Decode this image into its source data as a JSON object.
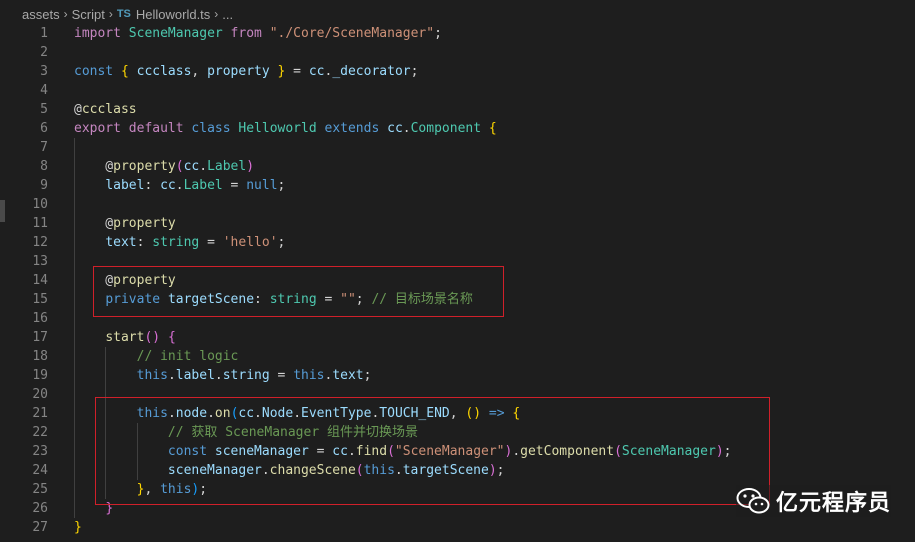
{
  "breadcrumb": {
    "items": [
      "assets",
      "Script",
      "Helloworld.ts",
      "..."
    ],
    "ts_badge": "TS"
  },
  "line_numbers": [
    "1",
    "2",
    "3",
    "4",
    "5",
    "6",
    "7",
    "8",
    "9",
    "10",
    "11",
    "12",
    "13",
    "14",
    "15",
    "16",
    "17",
    "18",
    "19",
    "20",
    "21",
    "22",
    "23",
    "24",
    "25",
    "26",
    "27"
  ],
  "code_lines": [
    [
      [
        "c",
        "import"
      ],
      [
        "p",
        " "
      ],
      [
        "t",
        "SceneManager"
      ],
      [
        "p",
        " "
      ],
      [
        "c",
        "from"
      ],
      [
        "p",
        " "
      ],
      [
        "s",
        "\"./Core/SceneManager\""
      ],
      [
        "p",
        ";"
      ]
    ],
    [],
    [
      [
        "k",
        "const"
      ],
      [
        "p",
        " "
      ],
      [
        "b1",
        "{"
      ],
      [
        "p",
        " "
      ],
      [
        "v",
        "ccclass"
      ],
      [
        "p",
        ", "
      ],
      [
        "v",
        "property"
      ],
      [
        "p",
        " "
      ],
      [
        "b1",
        "}"
      ],
      [
        "p",
        " = "
      ],
      [
        "v",
        "cc"
      ],
      [
        "p",
        "."
      ],
      [
        "v",
        "_decorator"
      ],
      [
        "p",
        ";"
      ]
    ],
    [],
    [
      [
        "p",
        "@"
      ],
      [
        "f",
        "ccclass"
      ]
    ],
    [
      [
        "c",
        "export"
      ],
      [
        "p",
        " "
      ],
      [
        "c",
        "default"
      ],
      [
        "p",
        " "
      ],
      [
        "k",
        "class"
      ],
      [
        "p",
        " "
      ],
      [
        "t",
        "Helloworld"
      ],
      [
        "p",
        " "
      ],
      [
        "k",
        "extends"
      ],
      [
        "p",
        " "
      ],
      [
        "v",
        "cc"
      ],
      [
        "p",
        "."
      ],
      [
        "t",
        "Component"
      ],
      [
        "p",
        " "
      ],
      [
        "b1",
        "{"
      ]
    ],
    [],
    [
      [
        "p",
        "    @"
      ],
      [
        "f",
        "property"
      ],
      [
        "b2",
        "("
      ],
      [
        "v",
        "cc"
      ],
      [
        "p",
        "."
      ],
      [
        "t",
        "Label"
      ],
      [
        "b2",
        ")"
      ]
    ],
    [
      [
        "p",
        "    "
      ],
      [
        "v",
        "label"
      ],
      [
        "p",
        ": "
      ],
      [
        "v",
        "cc"
      ],
      [
        "p",
        "."
      ],
      [
        "t",
        "Label"
      ],
      [
        "p",
        " = "
      ],
      [
        "k",
        "null"
      ],
      [
        "p",
        ";"
      ]
    ],
    [],
    [
      [
        "p",
        "    @"
      ],
      [
        "f",
        "property"
      ]
    ],
    [
      [
        "p",
        "    "
      ],
      [
        "v",
        "text"
      ],
      [
        "p",
        ": "
      ],
      [
        "t",
        "string"
      ],
      [
        "p",
        " = "
      ],
      [
        "s",
        "'hello'"
      ],
      [
        "p",
        ";"
      ]
    ],
    [],
    [
      [
        "p",
        "    @"
      ],
      [
        "f",
        "property"
      ]
    ],
    [
      [
        "p",
        "    "
      ],
      [
        "k",
        "private"
      ],
      [
        "p",
        " "
      ],
      [
        "v",
        "targetScene"
      ],
      [
        "p",
        ": "
      ],
      [
        "t",
        "string"
      ],
      [
        "p",
        " = "
      ],
      [
        "s",
        "\"\""
      ],
      [
        "p",
        "; "
      ],
      [
        "m",
        "// 目标场景名称"
      ]
    ],
    [],
    [
      [
        "p",
        "    "
      ],
      [
        "f",
        "start"
      ],
      [
        "b2",
        "()"
      ],
      [
        "p",
        " "
      ],
      [
        "b2",
        "{"
      ]
    ],
    [
      [
        "p",
        "        "
      ],
      [
        "m",
        "// init logic"
      ]
    ],
    [
      [
        "p",
        "        "
      ],
      [
        "k",
        "this"
      ],
      [
        "p",
        "."
      ],
      [
        "v",
        "label"
      ],
      [
        "p",
        "."
      ],
      [
        "v",
        "string"
      ],
      [
        "p",
        " = "
      ],
      [
        "k",
        "this"
      ],
      [
        "p",
        "."
      ],
      [
        "v",
        "text"
      ],
      [
        "p",
        ";"
      ]
    ],
    [],
    [
      [
        "p",
        "        "
      ],
      [
        "k",
        "this"
      ],
      [
        "p",
        "."
      ],
      [
        "v",
        "node"
      ],
      [
        "p",
        "."
      ],
      [
        "f",
        "on"
      ],
      [
        "b3",
        "("
      ],
      [
        "v",
        "cc"
      ],
      [
        "p",
        "."
      ],
      [
        "v",
        "Node"
      ],
      [
        "p",
        "."
      ],
      [
        "v",
        "EventType"
      ],
      [
        "p",
        "."
      ],
      [
        "v",
        "TOUCH_END"
      ],
      [
        "p",
        ", "
      ],
      [
        "b1",
        "()"
      ],
      [
        "p",
        " "
      ],
      [
        "k",
        "=>"
      ],
      [
        "p",
        " "
      ],
      [
        "b1",
        "{"
      ]
    ],
    [
      [
        "p",
        "            "
      ],
      [
        "m",
        "// 获取 SceneManager 组件并切换场景"
      ]
    ],
    [
      [
        "p",
        "            "
      ],
      [
        "k",
        "const"
      ],
      [
        "p",
        " "
      ],
      [
        "v",
        "sceneManager"
      ],
      [
        "p",
        " = "
      ],
      [
        "v",
        "cc"
      ],
      [
        "p",
        "."
      ],
      [
        "f",
        "find"
      ],
      [
        "b2",
        "("
      ],
      [
        "s",
        "\"SceneManager\""
      ],
      [
        "b2",
        ")"
      ],
      [
        "p",
        "."
      ],
      [
        "f",
        "getComponent"
      ],
      [
        "b2",
        "("
      ],
      [
        "t",
        "SceneManager"
      ],
      [
        "b2",
        ")"
      ],
      [
        "p",
        ";"
      ]
    ],
    [
      [
        "p",
        "            "
      ],
      [
        "v",
        "sceneManager"
      ],
      [
        "p",
        "."
      ],
      [
        "f",
        "changeScene"
      ],
      [
        "b2",
        "("
      ],
      [
        "k",
        "this"
      ],
      [
        "p",
        "."
      ],
      [
        "v",
        "targetScene"
      ],
      [
        "b2",
        ")"
      ],
      [
        "p",
        ";"
      ]
    ],
    [
      [
        "p",
        "        "
      ],
      [
        "b1",
        "}"
      ],
      [
        "p",
        ", "
      ],
      [
        "k",
        "this"
      ],
      [
        "b3",
        ")"
      ],
      [
        "p",
        ";"
      ]
    ],
    [
      [
        "p",
        "    "
      ],
      [
        "b2",
        "}"
      ]
    ],
    [
      [
        "b1",
        "}"
      ]
    ]
  ],
  "watermark": {
    "text": "亿元程序员",
    "icon": "wechat-icon"
  },
  "colors": {
    "background": "#1e1e1e",
    "highlight_border": "#d0202a"
  }
}
